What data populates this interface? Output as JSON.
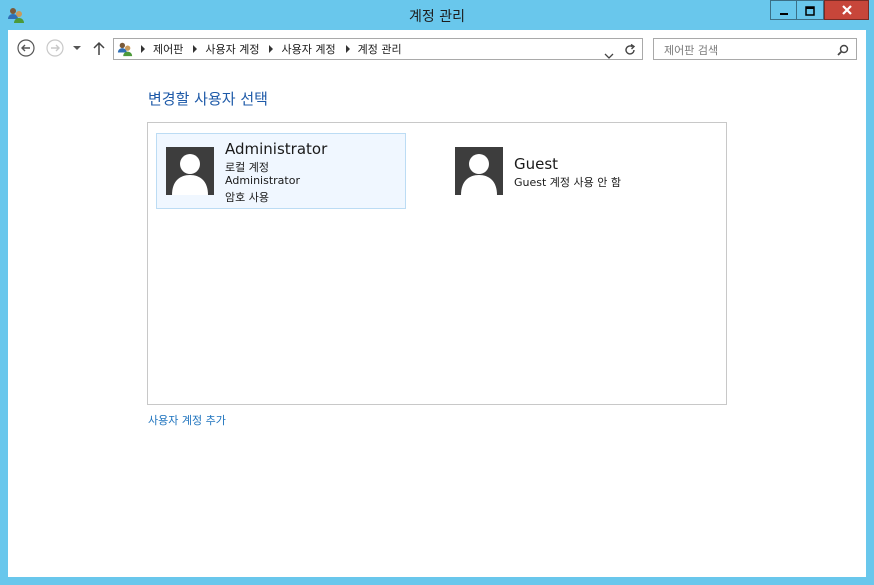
{
  "window": {
    "title": "계정 관리",
    "colors": {
      "frame": "#69c7ec",
      "close": "#c7463a",
      "heading": "#1e5aa8",
      "link": "#1e73be"
    },
    "controls": [
      "minimize-icon",
      "maximize-icon",
      "close-icon"
    ]
  },
  "nav": {
    "buttons": [
      "back-icon",
      "forward-icon",
      "recent-dropdown-icon",
      "up-icon"
    ],
    "breadcrumbs": [
      "제어판",
      "사용자 계정",
      "사용자 계정",
      "계정 관리"
    ],
    "search_placeholder": "제어판 검색"
  },
  "main": {
    "heading": "변경할 사용자 선택",
    "accounts": [
      {
        "name": "Administrator",
        "lines": [
          "로컬 계정",
          "Administrator",
          "암호 사용"
        ],
        "selected": true
      },
      {
        "name": "Guest",
        "lines": [
          "Guest 계정 사용 안 함"
        ],
        "selected": false
      }
    ],
    "add_link": "사용자 계정 추가"
  }
}
